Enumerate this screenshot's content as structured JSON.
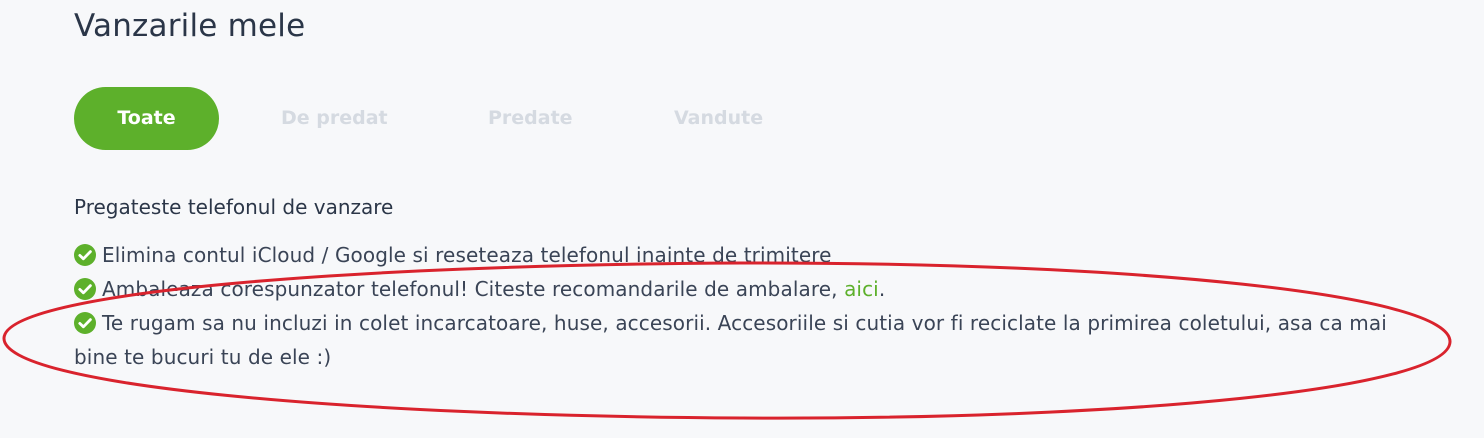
{
  "page": {
    "title": "Vanzarile mele"
  },
  "tabs": [
    {
      "label": "Toate",
      "active": true
    },
    {
      "label": "De predat",
      "active": false
    },
    {
      "label": "Predate",
      "active": false
    },
    {
      "label": "Vandute",
      "active": false
    }
  ],
  "prepare": {
    "title": "Pregateste telefonul de vanzare",
    "items": [
      {
        "text": "Elimina contul iCloud / Google si reseteaza telefonul inainte de trimitere"
      },
      {
        "text": "Ambaleaza corespunzator telefonul! Citeste recomandarile de ambalare, ",
        "link": "aici",
        "suffix": "."
      },
      {
        "text": "Te rugam sa nu incluzi in colet incarcatoare, huse, accesorii. Accesoriile si cutia vor fi reciclate la primirea coletului, asa ca mai bine te bucuri tu de ele :)"
      }
    ]
  },
  "colors": {
    "accent": "#5db02b",
    "inactive_tab": "#d5dae1",
    "background": "#f7f8fa",
    "annotation": "#d9232d"
  }
}
